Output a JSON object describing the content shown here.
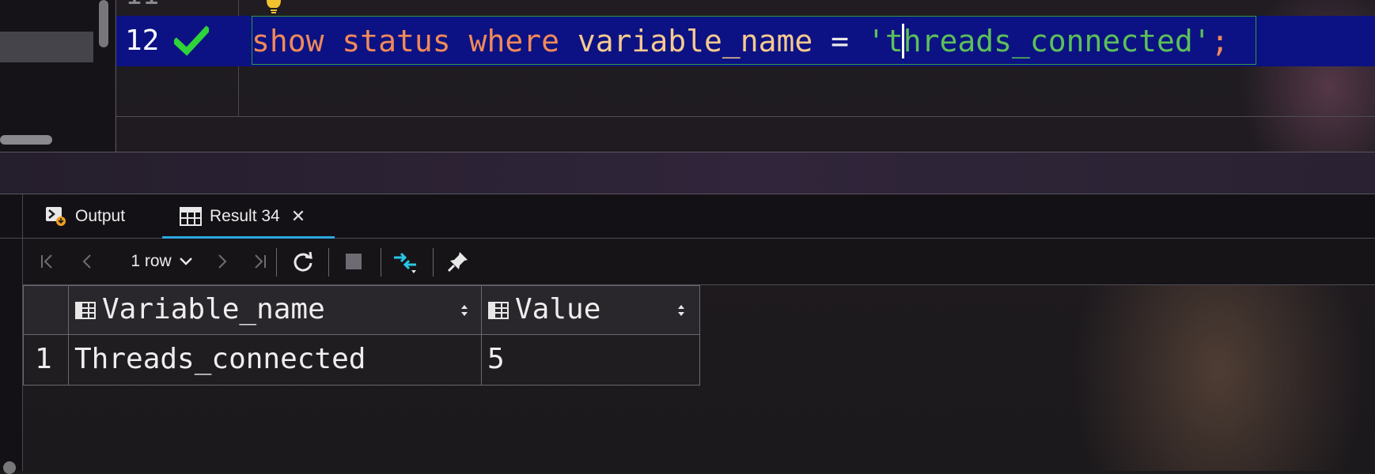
{
  "editor": {
    "prev_line_number": "11",
    "current_line_number": "12",
    "code": {
      "kw1": "show",
      "kw2": "status",
      "kw3": "where",
      "ident": "variable_name",
      "op": "=",
      "str_before_caret": "'t",
      "str_after_caret": "hreads_connected'",
      "semicolon": ";"
    }
  },
  "results": {
    "tabs": [
      {
        "label": "Output",
        "icon": "console-output-icon"
      },
      {
        "label": "Result 34",
        "icon": "table-grid-icon",
        "active": true
      }
    ],
    "toolbar": {
      "row_count_label": "1 row",
      "icons": [
        "first-page-icon",
        "prev-page-icon",
        "chevron-down-icon",
        "next-page-icon",
        "last-page-icon",
        "refresh-icon",
        "stop-icon",
        "compare-arrows-icon",
        "pin-icon"
      ]
    },
    "table": {
      "columns": [
        "Variable_name",
        "Value"
      ],
      "rows": [
        {
          "num": "1",
          "cells": [
            "Threads_connected",
            "5"
          ]
        }
      ]
    }
  },
  "colors": {
    "current_line_bg": "#0c1283",
    "keyword": "#f0895a",
    "identifier": "#f5c98f",
    "string": "#5cc05a",
    "check": "#2fd33a",
    "tab_underline": "#2aa7e0",
    "accent_icon": "#29c6e6"
  }
}
